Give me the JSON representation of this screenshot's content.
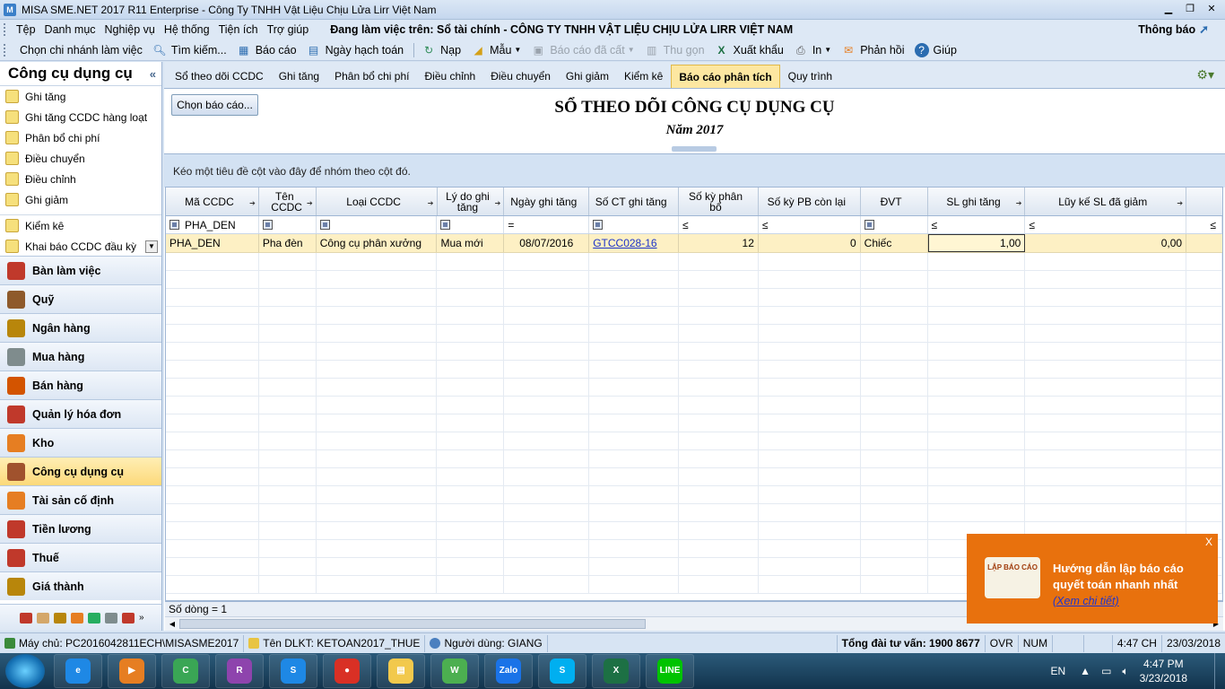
{
  "window": {
    "title": "MISA SME.NET 2017 R11 Enterprise - Công Ty TNHH Vật Liệu Chịu Lửa Lirr Việt Nam"
  },
  "menubar": {
    "items": [
      "Tệp",
      "Danh mục",
      "Nghiệp vụ",
      "Hệ thống",
      "Tiện ích",
      "Trợ giúp"
    ],
    "working_on": "Đang làm việc trên: Sổ tài chính - CÔNG TY TNHH VẬT LIỆU CHỊU LỬA LIRR VIỆT NAM",
    "notification": "Thông báo"
  },
  "toolbar": {
    "items": [
      {
        "label": "Chọn chi nhánh làm việc",
        "icon": "branch-icon",
        "disabled": false
      },
      {
        "label": "Tìm kiếm...",
        "icon": "search-icon",
        "disabled": false
      },
      {
        "label": "Báo cáo",
        "icon": "report-icon",
        "disabled": false
      },
      {
        "label": "Ngày hạch toán",
        "icon": "calendar-icon",
        "disabled": false
      },
      {
        "label": "Nạp",
        "icon": "refresh-icon",
        "disabled": false
      },
      {
        "label": "Mẫu",
        "icon": "template-icon",
        "disabled": false
      },
      {
        "label": "Báo cáo đã cất",
        "icon": "save-icon",
        "disabled": true
      },
      {
        "label": "Thu gọn",
        "icon": "collapse-icon",
        "disabled": true
      },
      {
        "label": "Xuất khẩu",
        "icon": "excel-icon",
        "disabled": false
      },
      {
        "label": "In",
        "icon": "print-icon",
        "disabled": false
      },
      {
        "label": "Phản hồi",
        "icon": "mail-icon",
        "disabled": false
      },
      {
        "label": "Giúp",
        "icon": "help-icon",
        "disabled": false
      }
    ]
  },
  "sidebar": {
    "title": "Công cụ dụng cụ",
    "tasks": [
      "Ghi tăng",
      "Ghi tăng CCDC hàng loạt",
      "Phân bổ chi phí",
      "Điều chuyển",
      "Điều chỉnh",
      "Ghi giảm",
      "Kiểm kê",
      "Khai báo CCDC đầu kỳ"
    ],
    "modules": [
      {
        "label": "Bàn làm việc",
        "color": "#c0392b"
      },
      {
        "label": "Quỹ",
        "color": "#8e5a2b"
      },
      {
        "label": "Ngân hàng",
        "color": "#b8860b"
      },
      {
        "label": "Mua hàng",
        "color": "#7f8c8d"
      },
      {
        "label": "Bán hàng",
        "color": "#d35400"
      },
      {
        "label": "Quản lý hóa đơn",
        "color": "#c0392b"
      },
      {
        "label": "Kho",
        "color": "#e67e22"
      },
      {
        "label": "Công cụ dụng cụ",
        "color": "#a0522d",
        "active": true
      },
      {
        "label": "Tài sản cố định",
        "color": "#e67e22"
      },
      {
        "label": "Tiền lương",
        "color": "#c0392b"
      },
      {
        "label": "Thuế",
        "color": "#c0392b"
      },
      {
        "label": "Giá thành",
        "color": "#b8860b"
      }
    ]
  },
  "tabs": [
    "Sổ theo dõi CCDC",
    "Ghi tăng",
    "Phân bổ chi phí",
    "Điều chỉnh",
    "Điều chuyển",
    "Ghi giảm",
    "Kiểm kê",
    "Báo cáo phân tích",
    "Quy trình"
  ],
  "active_tab": "Báo cáo phân tích",
  "report": {
    "choose_button": "Chọn báo cáo...",
    "title": "SỔ THEO DÕI CÔNG CỤ DỤNG CỤ",
    "subtitle": "Năm 2017",
    "group_hint": "Kéo một tiêu đề cột vào đây để nhóm theo cột đó."
  },
  "grid": {
    "columns": [
      "Mã CCDC",
      "Tên CCDC",
      "Loại CCDC",
      "Lý do ghi tăng",
      "Ngày ghi tăng",
      "Số CT ghi tăng",
      "Số kỳ phân bổ",
      "Số kỳ PB còn lại",
      "ĐVT",
      "SL ghi tăng",
      "Lũy kế SL đã giảm"
    ],
    "filter": {
      "ma_ccdc": "PHA_DEN",
      "ngay_op": "=",
      "le_op": "≤"
    },
    "rows": [
      {
        "ma": "PHA_DEN",
        "ten": "Pha đèn",
        "loai": "Công cụ phân xưởng",
        "lydo": "Mua mới",
        "ngay": "08/07/2016",
        "soct": "GTCC028-16",
        "soky": "12",
        "sokyconlai": "0",
        "dvt": "Chiếc",
        "sl": "1,00",
        "luyke": "0,00"
      }
    ],
    "row_count": "Số dòng = 1"
  },
  "popup": {
    "image_text": "LẬP BÁO CÁO",
    "message": "Hướng dẫn lập báo cáo quyết toán nhanh nhất",
    "link": "(Xem chi tiết)",
    "close": "X"
  },
  "statusbar": {
    "server": "Máy chủ: PC2016042811ECH\\MISASME2017",
    "db": "Tên DLKT: KETOAN2017_THUE",
    "user": "Người dùng: GIANG",
    "hotline": "Tổng đài tư vấn: 1900 8677",
    "ovr": "OVR",
    "num": "NUM",
    "time": "4:47 CH",
    "date": "23/03/2018"
  },
  "taskbar": {
    "lang": "EN",
    "clock_time": "4:47 PM",
    "clock_date": "3/23/2018",
    "apps": [
      {
        "name": "ie",
        "color": "#1e88e5",
        "glyph": "e"
      },
      {
        "name": "media",
        "color": "#e67e22",
        "glyph": "▶"
      },
      {
        "name": "coccoc",
        "color": "#3aa655",
        "glyph": "C"
      },
      {
        "name": "winrar",
        "color": "#8e44ad",
        "glyph": "R"
      },
      {
        "name": "skype-s",
        "color": "#1e88e5",
        "glyph": "S"
      },
      {
        "name": "chrome",
        "color": "#d93025",
        "glyph": "●"
      },
      {
        "name": "explorer",
        "color": "#f2c94c",
        "glyph": "▤"
      },
      {
        "name": "wechat",
        "color": "#4caf50",
        "glyph": "W"
      },
      {
        "name": "zalo",
        "color": "#1a73e8",
        "glyph": "Zalo"
      },
      {
        "name": "skype",
        "color": "#00aff0",
        "glyph": "S"
      },
      {
        "name": "excel",
        "color": "#1d7044",
        "glyph": "X"
      },
      {
        "name": "line",
        "color": "#00c300",
        "glyph": "LINE"
      }
    ]
  }
}
